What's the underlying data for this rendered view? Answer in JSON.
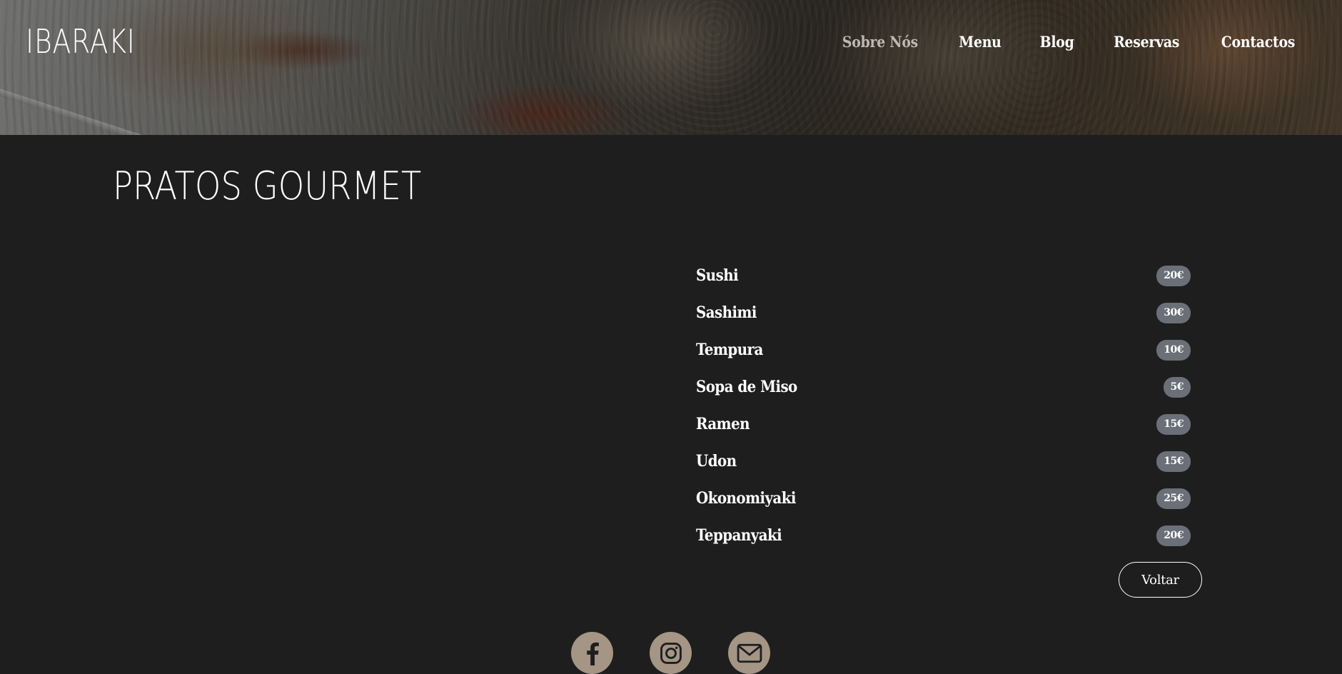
{
  "header": {
    "logo": "IBARAKI",
    "nav": [
      {
        "label": "Sobre Nós"
      },
      {
        "label": "Menu"
      },
      {
        "label": "Blog"
      },
      {
        "label": "Reservas"
      },
      {
        "label": "Contactos"
      }
    ]
  },
  "main": {
    "title": "PRATOS GOURMET",
    "dishes": [
      {
        "name": "Sushi",
        "price": "20€"
      },
      {
        "name": "Sashimi",
        "price": "30€"
      },
      {
        "name": "Tempura",
        "price": "10€"
      },
      {
        "name": "Sopa de Miso",
        "price": "5€"
      },
      {
        "name": "Ramen",
        "price": "15€"
      },
      {
        "name": "Udon",
        "price": "15€"
      },
      {
        "name": "Okonomiyaki",
        "price": "25€"
      },
      {
        "name": "Teppanyaki",
        "price": "20€"
      }
    ],
    "back_label": "Voltar"
  },
  "footer": {
    "socials": [
      {
        "icon": "facebook-icon"
      },
      {
        "icon": "instagram-icon"
      },
      {
        "icon": "mail-icon"
      }
    ]
  },
  "colors": {
    "background": "#1e1e1e",
    "price_badge": "#6b6f77",
    "social_circle": "#a49584",
    "nav_muted": "#bdb9b2"
  }
}
